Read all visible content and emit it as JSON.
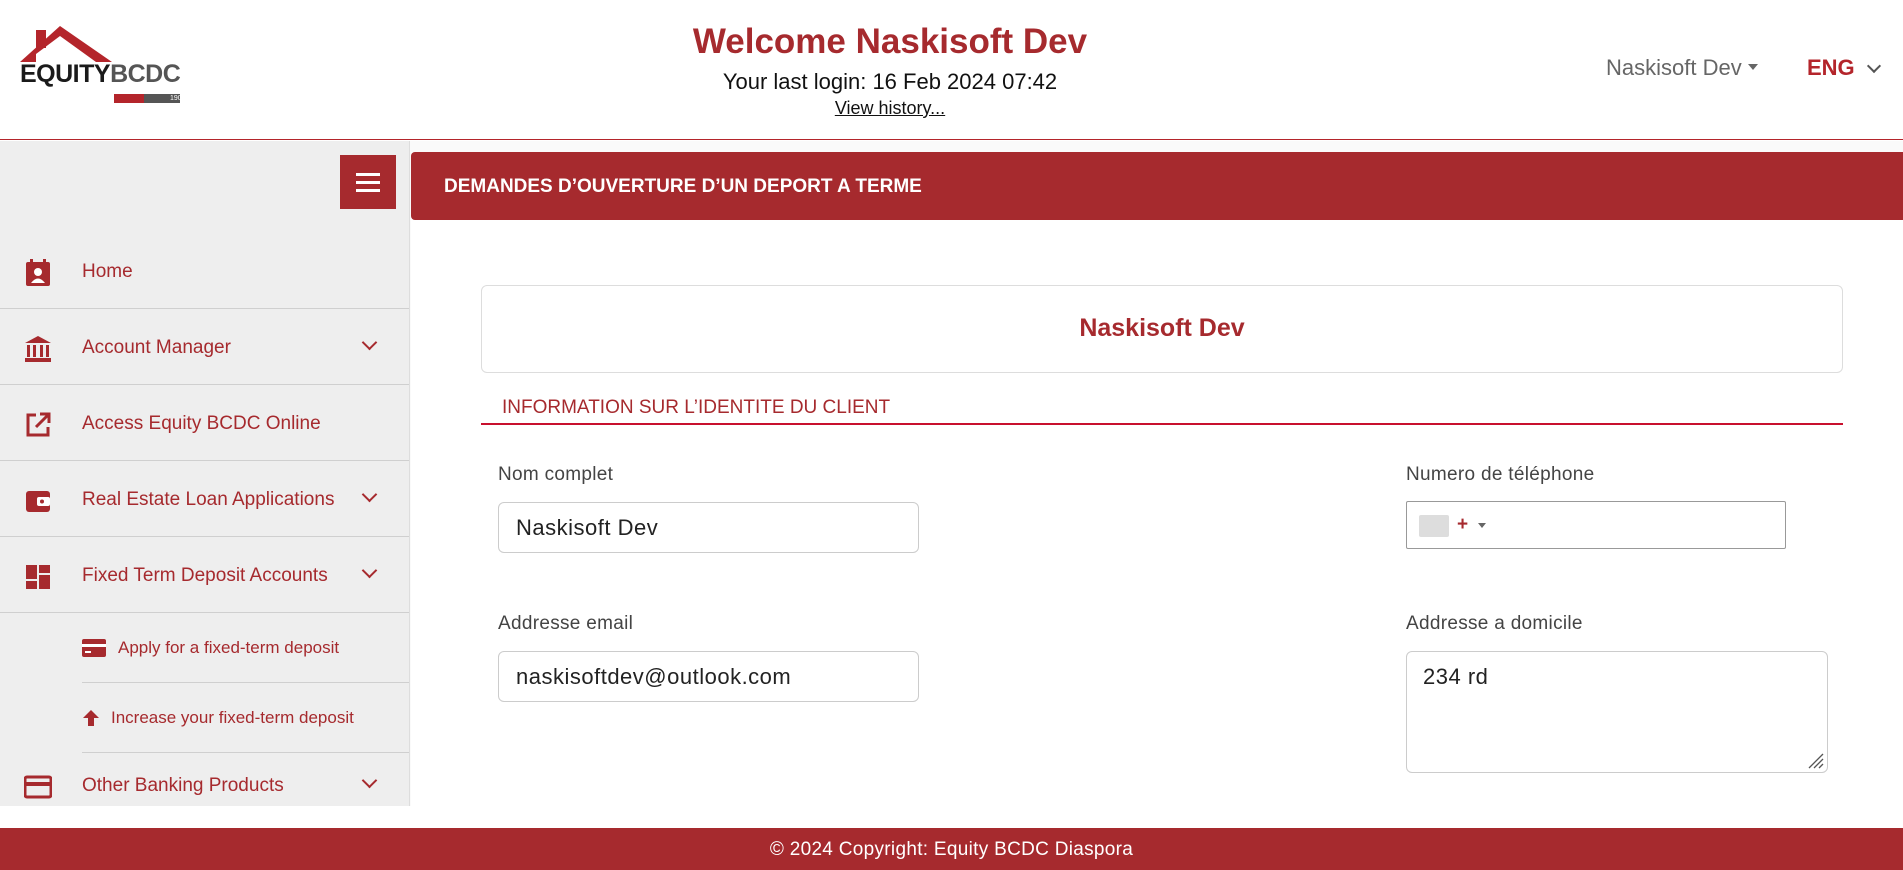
{
  "brand": {
    "name_primary": "EQUITY",
    "name_secondary": "BCDC",
    "year": "1909"
  },
  "header": {
    "welcome": "Welcome Naskisoft Dev",
    "last_login": "Your last login: 16 Feb 2024 07:42",
    "history_link": "View history...",
    "user_menu": "Naskisoft Dev",
    "language": "ENG"
  },
  "sidebar": {
    "items": [
      {
        "label": "Home",
        "icon": "calendar-user-icon"
      },
      {
        "label": "Account Manager",
        "icon": "bank-icon",
        "expandable": true
      },
      {
        "label": "Access Equity BCDC Online",
        "icon": "external-link-icon"
      },
      {
        "label": "Real Estate Loan Applications",
        "icon": "wallet-icon",
        "expandable": true
      },
      {
        "label": "Fixed Term Deposit Accounts",
        "icon": "dashboard-icon",
        "expandable": true
      },
      {
        "label": "Other Banking Products",
        "icon": "credit-card-icon",
        "expandable": true
      }
    ],
    "subitems": [
      {
        "label": "Apply for a fixed-term deposit",
        "icon": "credit-card-icon"
      },
      {
        "label": "Increase your fixed-term deposit",
        "icon": "arrow-up-icon"
      }
    ]
  },
  "main": {
    "title": "DEMANDES D’OUVERTURE D’UN DEPORT A TERME",
    "client_name": "Naskisoft Dev",
    "section_heading": "INFORMATION SUR L’IDENTITE DU CLIENT",
    "form": {
      "full_name_label": "Nom complet",
      "full_name_value": "Naskisoft Dev",
      "phone_label": "Numero de téléphone",
      "phone_dial": "+",
      "email_label": "Addresse email",
      "email_value": "naskisoftdev@outlook.com",
      "address_label": "Addresse a domicile",
      "address_value": "234 rd"
    }
  },
  "footer": {
    "copyright": "© 2024 Copyright: Equity BCDC Diaspora"
  },
  "colors": {
    "brand_red": "#a62a2e",
    "sidebar_bg": "#eeeeee"
  }
}
